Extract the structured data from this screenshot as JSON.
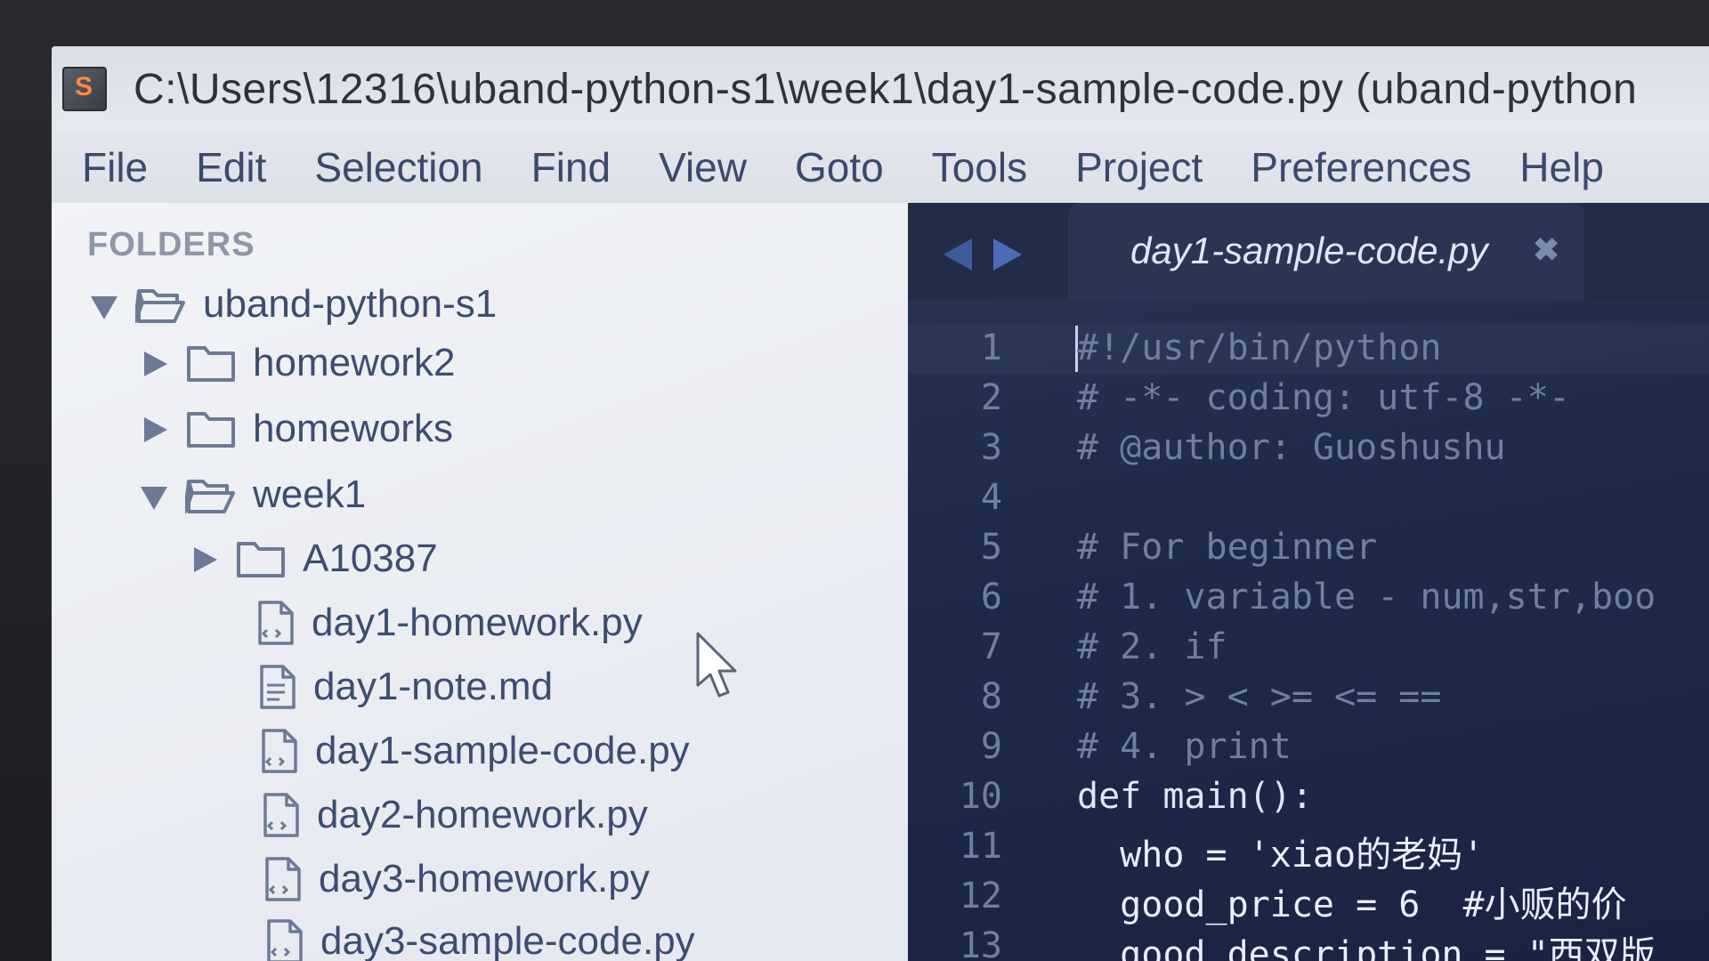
{
  "window": {
    "app_icon_letter": "S",
    "title": "C:\\Users\\12316\\uband-python-s1\\week1\\day1-sample-code.py (uband-python"
  },
  "menu": [
    "File",
    "Edit",
    "Selection",
    "Find",
    "View",
    "Goto",
    "Tools",
    "Project",
    "Preferences",
    "Help"
  ],
  "sidebar": {
    "header": "FOLDERS",
    "tree": [
      {
        "label": "uband-python-s1",
        "type": "folder",
        "expanded": true,
        "depth": 0
      },
      {
        "label": "homework2",
        "type": "folder",
        "expanded": false,
        "depth": 1
      },
      {
        "label": "homeworks",
        "type": "folder",
        "expanded": false,
        "depth": 1
      },
      {
        "label": "week1",
        "type": "folder",
        "expanded": true,
        "depth": 1
      },
      {
        "label": "A10387",
        "type": "folder",
        "expanded": false,
        "depth": 2
      },
      {
        "label": "day1-homework.py",
        "type": "file",
        "depth": 2
      },
      {
        "label": "day1-note.md",
        "type": "file",
        "depth": 2
      },
      {
        "label": "day1-sample-code.py",
        "type": "file",
        "depth": 2
      },
      {
        "label": "day2-homework.py",
        "type": "file",
        "depth": 2
      },
      {
        "label": "day3-homework.py",
        "type": "file",
        "depth": 2
      },
      {
        "label": "day3-sample-code.py",
        "type": "file",
        "depth": 2
      }
    ]
  },
  "editor": {
    "tab_title": "day1-sample-code.py",
    "tab_close": "✖",
    "line_numbers": [
      "1",
      "2",
      "3",
      "4",
      "5",
      "6",
      "7",
      "8",
      "9",
      "10",
      "11",
      "12",
      "13"
    ],
    "lines": [
      "#!/usr/bin/python",
      "# -*- coding: utf-8 -*-",
      "# @author: Guoshushu",
      "",
      "# For beginner",
      "# 1. variable - num,str,boo",
      "# 2. if",
      "# 3. > < >= <= ==",
      "# 4. print",
      "def main():",
      "  who = 'xiao的老妈'",
      "  good_price = 6  #小贩的价",
      "  good_description = \"西双版"
    ]
  },
  "colors": {
    "editor_bg": "#1f2a4a",
    "comment": "#6f7ea2",
    "keyword": "#5fa7e6",
    "operator": "#e05b6b",
    "number": "#c57ae0",
    "sidebar_text": "#3d4d70"
  }
}
